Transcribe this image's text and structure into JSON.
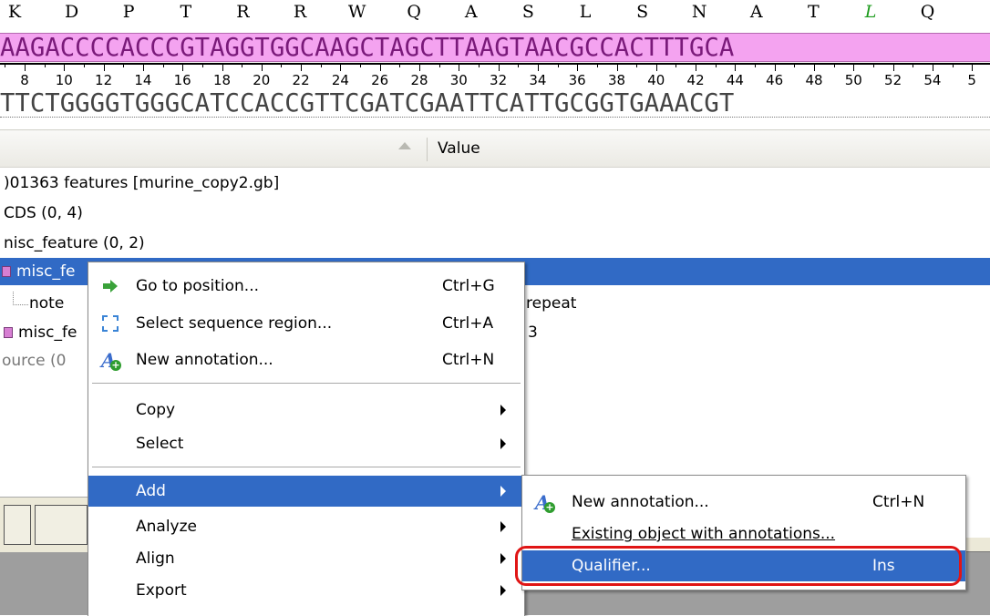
{
  "sequence": {
    "amino_acids": [
      {
        "letter": "K"
      },
      {
        "letter": "D"
      },
      {
        "letter": "P"
      },
      {
        "letter": "T"
      },
      {
        "letter": "R"
      },
      {
        "letter": "R"
      },
      {
        "letter": "W"
      },
      {
        "letter": "Q"
      },
      {
        "letter": "A"
      },
      {
        "letter": "S"
      },
      {
        "letter": "L"
      },
      {
        "letter": "S"
      },
      {
        "letter": "N"
      },
      {
        "letter": "A"
      },
      {
        "letter": "T"
      },
      {
        "letter": "L",
        "color": "#1a9a1a"
      },
      {
        "letter": "Q"
      }
    ],
    "top_strand": "AAGACCCCACCCGTAGGTGGCAAGCTAGCTTAAGTAACGCCACTTTGCA",
    "ruler_numbers": [
      "8",
      "10",
      "12",
      "14",
      "16",
      "18",
      "20",
      "22",
      "24",
      "26",
      "28",
      "30",
      "32",
      "34",
      "36",
      "38",
      "40",
      "42",
      "44",
      "46",
      "48",
      "50",
      "52",
      "54",
      "5"
    ],
    "bottom_strand": "TTCTGGGGTGGGCATCCACCGTTCGATCGAATTCATTGCGGTGAAACGT"
  },
  "tree": {
    "column_value": "Value",
    "rows": [
      {
        "text": ")01363 features [murine_copy2.gb]"
      },
      {
        "text": "CDS  (0, 4)"
      },
      {
        "text": "nisc_feature  (0, 2)"
      },
      {
        "text": "misc_fe"
      },
      {
        "text": "note"
      },
      {
        "text": "misc_fe"
      },
      {
        "text": "ource  (0"
      }
    ],
    "value_fragments": {
      "repeat": "repeat",
      "three": "3"
    }
  },
  "context_menu": {
    "items": [
      {
        "label": "Go to position...",
        "shortcut": "Ctrl+G",
        "icon": "go-arrow-icon"
      },
      {
        "label": "Select sequence region...",
        "shortcut": "Ctrl+A",
        "icon": "select-region-icon"
      },
      {
        "label": "New annotation...",
        "shortcut": "Ctrl+N",
        "icon": "new-annotation-icon"
      },
      {
        "label": "Copy"
      },
      {
        "label": "Select"
      },
      {
        "label": "Add"
      },
      {
        "label": "Analyze"
      },
      {
        "label": "Align"
      },
      {
        "label": "Export"
      }
    ]
  },
  "submenu": {
    "items": [
      {
        "label": "New annotation...",
        "shortcut": "Ctrl+N",
        "icon": "new-annotation-icon"
      },
      {
        "label": "Existing object with annotations..."
      },
      {
        "label": "Qualifier...",
        "shortcut": "Ins"
      }
    ]
  },
  "colors": {
    "selection": "#316ac5",
    "annotation_pink": "#f4a3f0",
    "highlight_ring": "#e01515"
  }
}
